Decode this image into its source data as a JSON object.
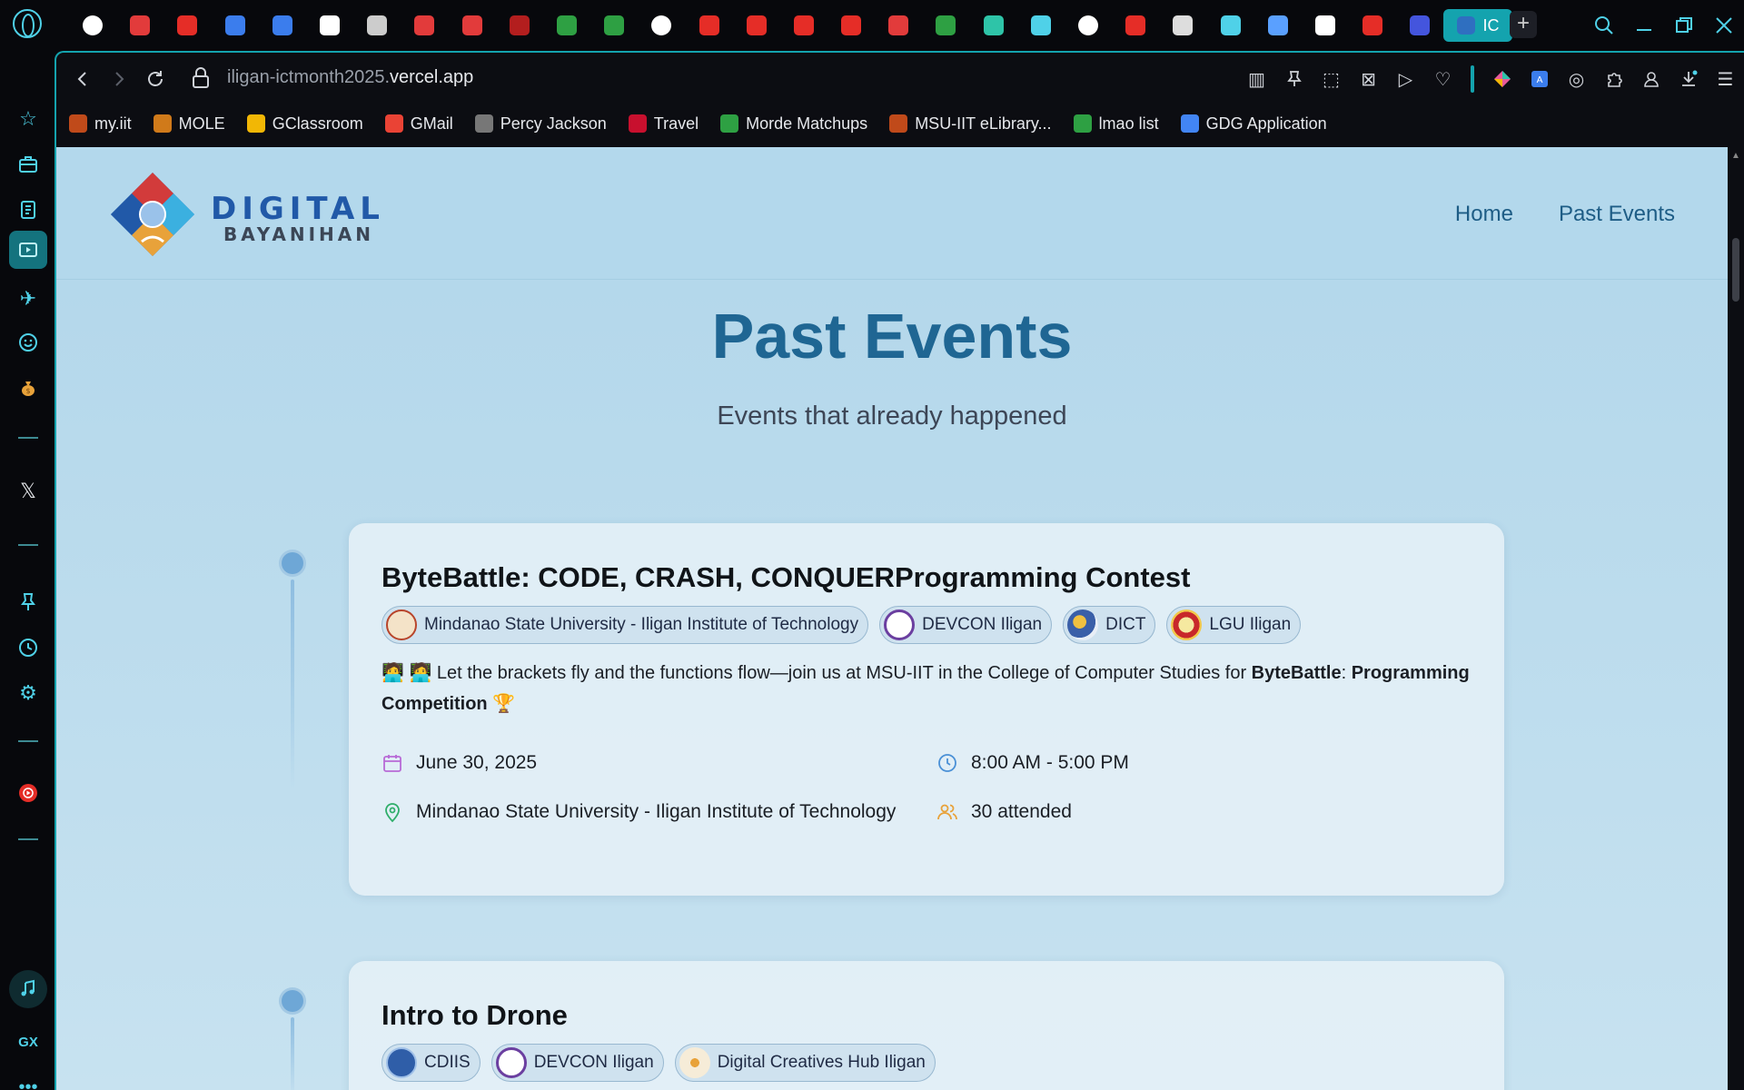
{
  "browser": {
    "tabs": [
      {
        "icon": "github-icon",
        "color": "#ffffff"
      },
      {
        "icon": "red-mascot-icon",
        "color": "#e23b3b"
      },
      {
        "icon": "youtube-icon",
        "color": "#e52d27"
      },
      {
        "icon": "google-docs-icon",
        "color": "#3b7ded"
      },
      {
        "icon": "google-docs-icon",
        "color": "#3b7ded"
      },
      {
        "icon": "white-square-icon",
        "color": "#ffffff"
      },
      {
        "icon": "globe-icon",
        "color": "#cccccc"
      },
      {
        "icon": "red-mascot-icon",
        "color": "#e23b3b"
      },
      {
        "icon": "red-mascot-icon",
        "color": "#e23b3b"
      },
      {
        "icon": "film-icon",
        "color": "#b31e1e"
      },
      {
        "icon": "k-icon",
        "color": "#2ea043"
      },
      {
        "icon": "k-icon",
        "color": "#2ea043"
      },
      {
        "icon": "openai-icon",
        "color": "#ffffff"
      },
      {
        "icon": "youtube-icon",
        "color": "#e52d27"
      },
      {
        "icon": "youtube-icon",
        "color": "#e52d27"
      },
      {
        "icon": "youtube-icon",
        "color": "#e52d27"
      },
      {
        "icon": "youtube-icon",
        "color": "#e52d27"
      },
      {
        "icon": "cake-icon",
        "color": "#e23b3b"
      },
      {
        "icon": "green-plus-icon",
        "color": "#2ea043"
      },
      {
        "icon": "vine-icon",
        "color": "#2ec4a8"
      },
      {
        "icon": "mouse-icon",
        "color": "#4fd1e8"
      },
      {
        "icon": "google-icon",
        "color": "#ffffff"
      },
      {
        "icon": "youtube-icon",
        "color": "#e52d27"
      },
      {
        "icon": "clapper-icon",
        "color": "#dddddd"
      },
      {
        "icon": "mouse-icon",
        "color": "#4fd1e8"
      },
      {
        "icon": "gemini-icon",
        "color": "#5aa0ff"
      },
      {
        "icon": "white-square-icon",
        "color": "#ffffff"
      },
      {
        "icon": "youtube-icon",
        "color": "#e52d27"
      },
      {
        "icon": "bank-icon",
        "color": "#4455dd"
      }
    ],
    "active_tab_label": "IC",
    "url_prefix": "iligan-ictmonth2025.",
    "url_domain": "vercel.app",
    "bookmarks": [
      {
        "label": "my.iit",
        "color": "#c04a1a"
      },
      {
        "label": "MOLE",
        "color": "#d07a1a"
      },
      {
        "label": "GClassroom",
        "color": "#f2b705"
      },
      {
        "label": "GMail",
        "color": "#ea4335"
      },
      {
        "label": "Percy Jackson",
        "color": "#777777"
      },
      {
        "label": "Travel",
        "color": "#c8102e"
      },
      {
        "label": "Morde Matchups",
        "color": "#2ea043"
      },
      {
        "label": "MSU-IIT eLibrary...",
        "color": "#c04a1a"
      },
      {
        "label": "lmao list",
        "color": "#2ea043"
      },
      {
        "label": "GDG Application",
        "color": "#4285f4"
      }
    ]
  },
  "site": {
    "logo_line1": "DIGITAL",
    "logo_line2": "BAYANIHAN",
    "nav": [
      {
        "label": "Home"
      },
      {
        "label": "Past Events"
      }
    ],
    "title": "Past Events",
    "subtitle": "Events that already happened"
  },
  "events": [
    {
      "title": "ByteBattle: CODE, CRASH, CONQUERProgramming Contest",
      "organizers": [
        {
          "name": "Mindanao State University - Iligan Institute of Technology",
          "color": "#b8452b"
        },
        {
          "name": "DEVCON Iligan",
          "color": "#6b3fa0"
        },
        {
          "name": "DICT",
          "color": "#3a5fa8"
        },
        {
          "name": "LGU Iligan",
          "color": "#c8282a"
        }
      ],
      "description_prefix": "🧑‍💻 🧑‍💻 Let the brackets fly and the functions flow—join us at MSU-IIT in the College of Computer Studies for ",
      "description_bold1": "ByteBattle",
      "description_mid": ": ",
      "description_bold2": "Programming Competition",
      "description_suffix": " 🏆",
      "date": "June 30, 2025",
      "time": "8:00 AM - 5:00 PM",
      "venue": "Mindanao State University - Iligan Institute of Technology",
      "attendance": "30 attended"
    },
    {
      "title": "Intro to Drone",
      "organizers": [
        {
          "name": "CDIIS",
          "color": "#2f5ea8"
        },
        {
          "name": "DEVCON Iligan",
          "color": "#6b3fa0"
        },
        {
          "name": "Digital Creatives Hub Iligan",
          "color": "#e8a23a"
        }
      ]
    }
  ],
  "colors": {
    "accent": "#14a3ae",
    "title": "#1f6693",
    "page_bg": "#b1d6ea"
  }
}
